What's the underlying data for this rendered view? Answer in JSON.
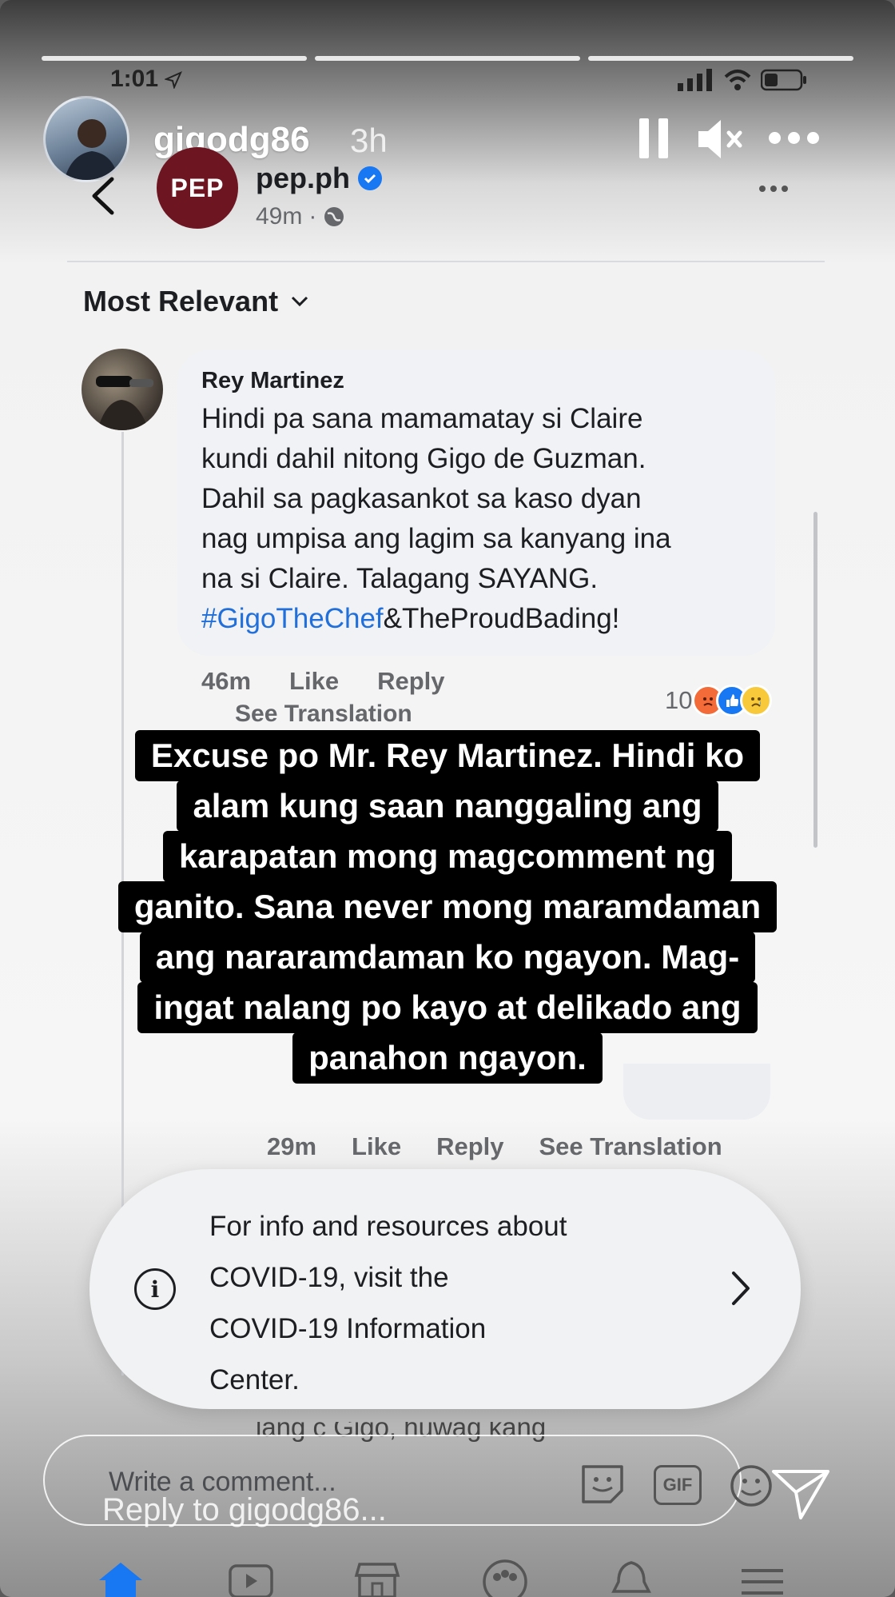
{
  "story": {
    "status_time": "1:01",
    "username": "gigodg86",
    "posted_ago": "3h",
    "progress_segments": 3
  },
  "post": {
    "page_logo_text": "PEP",
    "page_name": "pep.ph",
    "time": "49m"
  },
  "sort_label": "Most Relevant",
  "comment": {
    "author": "Rey Martinez",
    "text_lines": [
      "Hindi pa sana mamamatay si Claire",
      "kundi dahil nitong Gigo de Guzman.",
      "Dahil sa pagkasankot sa kaso dyan",
      "nag umpisa ang lagim sa kanyang ina",
      "na si Claire. Talagang SAYANG."
    ],
    "hashtag": "#GigoTheChef",
    "hashtag_suffix": "&TheProudBading!",
    "time": "46m",
    "like_label": "Like",
    "reply_label": "Reply",
    "see_translation": "See Translation",
    "reaction_count": "10"
  },
  "overlay_text": {
    "lines": [
      "Excuse po Mr. Rey Martinez. Hindi ko",
      "alam kung saan nanggaling ang",
      "karapatan mong magcomment ng",
      "ganito. Sana never mong maramdaman",
      "ang nararamdaman ko ngayon. Mag-",
      "ingat nalang po kayo at delikado ang",
      "panahon ngayon."
    ]
  },
  "reply": {
    "time": "29m",
    "like_label": "Like",
    "reply_label": "Reply",
    "see_translation": "See Translation"
  },
  "covid_banner": {
    "lines": [
      "For info and resources about",
      "COVID-19, visit the",
      "COVID-19 Information",
      "Center."
    ]
  },
  "partial_comment": "lang c Gigo, huwag kang",
  "composer": {
    "placeholder": "Write a comment...",
    "gif_label": "GIF"
  },
  "story_reply": {
    "placeholder": "Reply to gigodg86..."
  },
  "colors": {
    "link_blue": "#216fdb",
    "verified_blue": "#1877f2",
    "pep_maroon": "#6d1622",
    "overlay_bg": "#000000"
  }
}
